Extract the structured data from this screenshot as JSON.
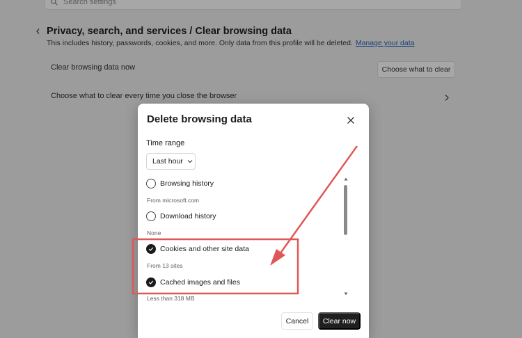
{
  "colors": {
    "overlay_bg": "#9c9c9c",
    "dialog_bg": "#ffffff",
    "primary_button": "#1f1f1f",
    "link": "#1a3f7a",
    "annotation_red": "#e05757"
  },
  "background_page": {
    "search_placeholder": "Search settings",
    "title": "Privacy, search, and services  /  Clear browsing data",
    "subtitle": "This includes history, passwords, cookies, and more. Only data from this profile will be deleted.",
    "manage_link": "Manage your data",
    "row1_label": "Clear browsing data now",
    "row1_button": "Choose what to clear",
    "row2_label": "Choose what to clear every time you close the browser"
  },
  "dialog": {
    "title": "Delete browsing data",
    "time_range_label": "Time range",
    "time_range_value": "Last hour",
    "options": [
      {
        "label": "Browsing history",
        "checked": false,
        "detail": "From microsoft.com"
      },
      {
        "label": "Download history",
        "checked": false,
        "detail": "None"
      },
      {
        "label": "Cookies and other site data",
        "checked": true,
        "detail": "From 13 sites"
      },
      {
        "label": "Cached images and files",
        "checked": true,
        "detail": "Less than 318 MB"
      }
    ],
    "cancel_label": "Cancel",
    "confirm_label": "Clear now"
  }
}
